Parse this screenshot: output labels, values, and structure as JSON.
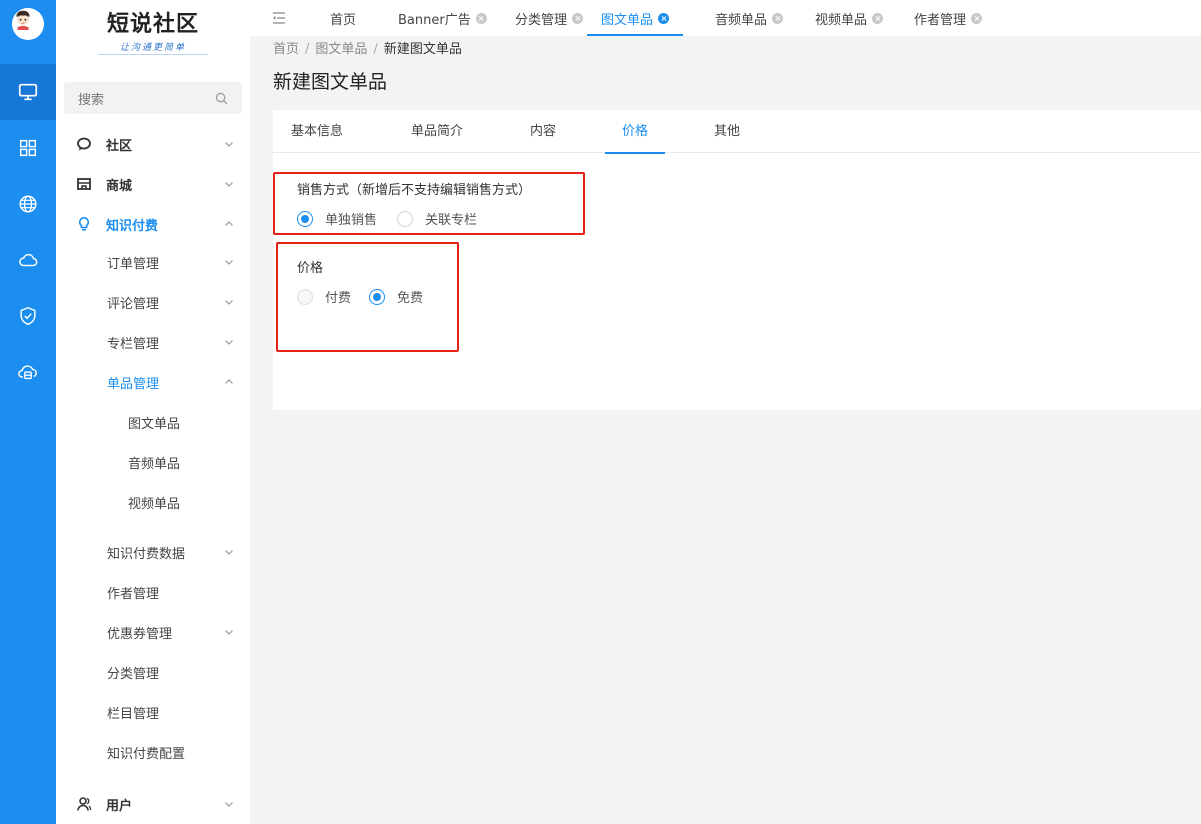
{
  "rail": {
    "icons": [
      "monitor-icon",
      "grid-icon",
      "globe-icon",
      "cloud-icon",
      "shield-check-icon",
      "cloud-storage-icon"
    ]
  },
  "sidebar": {
    "logo_title": "短说社区",
    "logo_slogan": "让沟通更简单",
    "search_placeholder": "搜索",
    "items": [
      {
        "label": "社区"
      },
      {
        "label": "商城"
      },
      {
        "label": "知识付费"
      },
      {
        "label": "订单管理"
      },
      {
        "label": "评论管理"
      },
      {
        "label": "专栏管理"
      },
      {
        "label": "单品管理"
      },
      {
        "label": "图文单品"
      },
      {
        "label": "音频单品"
      },
      {
        "label": "视频单品"
      },
      {
        "label": "知识付费数据"
      },
      {
        "label": "作者管理"
      },
      {
        "label": "优惠券管理"
      },
      {
        "label": "分类管理"
      },
      {
        "label": "栏目管理"
      },
      {
        "label": "知识付费配置"
      },
      {
        "label": "用户"
      }
    ]
  },
  "tabs": [
    {
      "label": "首页"
    },
    {
      "label": "Banner广告"
    },
    {
      "label": "分类管理"
    },
    {
      "label": "图文单品"
    },
    {
      "label": "音频单品"
    },
    {
      "label": "视频单品"
    },
    {
      "label": "作者管理"
    }
  ],
  "breadcrumb": {
    "home": "首页",
    "section": "图文单品",
    "current": "新建图文单品",
    "separator": "/"
  },
  "page_title": "新建图文单品",
  "form_tabs": [
    {
      "label": "基本信息"
    },
    {
      "label": "单品简介"
    },
    {
      "label": "内容"
    },
    {
      "label": "价格"
    },
    {
      "label": "其他"
    }
  ],
  "sale_mode": {
    "label": "销售方式（新增后不支持编辑销售方式）",
    "options": [
      {
        "label": "单独销售",
        "checked": true
      },
      {
        "label": "关联专栏",
        "checked": false
      }
    ]
  },
  "price": {
    "label": "价格",
    "options": [
      {
        "label": "付费",
        "checked": false
      },
      {
        "label": "免费",
        "checked": true
      }
    ]
  },
  "colors": {
    "accent": "#1b8ef0",
    "highlight_box": "#e62117"
  }
}
